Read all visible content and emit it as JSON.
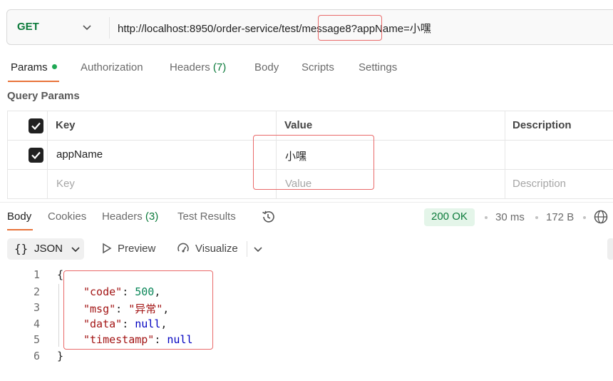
{
  "request": {
    "method": "GET",
    "url": "http://localhost:8950/order-service/test/message8?appName=小嘿"
  },
  "request_tabs": [
    {
      "label": "Params",
      "active": true,
      "has_dot": true
    },
    {
      "label": "Authorization"
    },
    {
      "label": "Headers",
      "count": "(7)"
    },
    {
      "label": "Body"
    },
    {
      "label": "Scripts"
    },
    {
      "label": "Settings"
    }
  ],
  "query_params": {
    "title": "Query Params",
    "headers": {
      "key": "Key",
      "value": "Value",
      "description": "Description"
    },
    "rows": [
      {
        "key": "appName",
        "value": "小嘿",
        "description": "",
        "checked": true
      }
    ],
    "placeholder": {
      "key": "Key",
      "value": "Value",
      "description": "Description"
    }
  },
  "response_tabs": [
    {
      "label": "Body",
      "active": true
    },
    {
      "label": "Cookies"
    },
    {
      "label": "Headers",
      "count": "(3)"
    },
    {
      "label": "Test Results"
    }
  ],
  "response_meta": {
    "status": "200 OK",
    "time": "30 ms",
    "size": "172 B"
  },
  "format_toolbar": {
    "format_icon": "{}",
    "format_label": "JSON",
    "preview_label": "Preview",
    "visualize_label": "Visualize"
  },
  "response_body": {
    "line_numbers": [
      "1",
      "2",
      "3",
      "4",
      "5",
      "6"
    ],
    "open_brace": "{",
    "close_brace": "}",
    "fields": [
      {
        "key": "\"code\"",
        "value": "500",
        "punct": ","
      },
      {
        "key": "\"msg\"",
        "value": "\"异常\"",
        "punct": ","
      },
      {
        "key": "\"data\"",
        "value": "null",
        "punct": ","
      },
      {
        "key": "\"timestamp\"",
        "value": "null",
        "punct": ""
      }
    ]
  },
  "colors": {
    "method_get": "#0b7a3a",
    "active_tab_underline": "#e8743b",
    "status_ok_bg": "#e4f5e9",
    "highlight_box": "#e96a6a"
  }
}
